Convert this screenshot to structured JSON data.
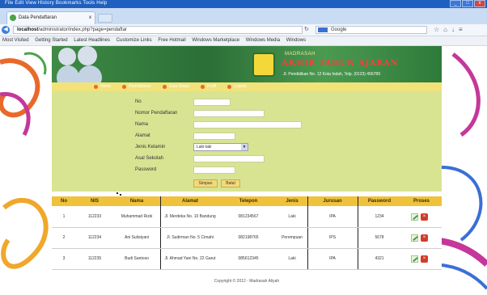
{
  "window": {
    "menu_text": "File  Edit  View  History  Bookmarks  Tools  Help",
    "min": "_",
    "max": "□",
    "close": "x"
  },
  "tab": {
    "label": "Data Pendaftaran",
    "close": "x"
  },
  "address": {
    "host": "localhost",
    "path": "/administrator/index.php?page=pendaftar",
    "search_engine": "Google",
    "search_placeholder": "Google"
  },
  "bookmarks": [
    "Most Visited",
    "Getting Started",
    "Latest Headlines",
    "Customize Links",
    "Free Hotmail",
    "Windows Marketplace",
    "Windows Media",
    "Windows"
  ],
  "banner": {
    "subtitle": "MADRASAH",
    "name": "AKHIR TAHUN AJARAN",
    "address": "Jl. Pendidikan No. 12 Kota Indah, Telp. (0123) 456789"
  },
  "menu": [
    "Home",
    "Pendaftaran",
    "Data Siswa",
    "Profil",
    "Logout"
  ],
  "form": {
    "fields": [
      "No",
      "Nomor Pendaftaran",
      "Nama",
      "Alamat",
      "Jenis Kelamin",
      "Asal Sekolah",
      "Password"
    ],
    "gender_selected": "Laki-laki",
    "submit_label": "Simpan",
    "reset_label": "Batal"
  },
  "table": {
    "headers": [
      "No",
      "NIS",
      "Nama",
      "Alamat",
      "Telepon",
      "Jenis",
      "Jurusan",
      "Password",
      "Proses"
    ],
    "rows": [
      [
        "1",
        "112233",
        "Muhammad Rizki",
        "Jl. Merdeka No. 10 Bandung",
        "081234567",
        "Laki",
        "IPA",
        "1234"
      ],
      [
        "2",
        "112234",
        "Ani Sulistyani",
        "Jl. Sudirman No. 5 Cimahi",
        "082198765",
        "Perempuan",
        "IPS",
        "5678"
      ],
      [
        "3",
        "112235",
        "Budi Santoso",
        "Jl. Ahmad Yani No. 22 Garut",
        "085612345",
        "Laki",
        "IPA",
        "4321"
      ]
    ]
  },
  "footer": "Copyright © 2012 - Madrasah Aliyah",
  "colors": {
    "banner": "#3f8a46",
    "menubar": "#f1e27a",
    "form": "#d9e493",
    "table_header": "#f0c23b",
    "title_bar": "#1f5fbf"
  },
  "icons": [
    "favicon",
    "back-icon",
    "reload-icon",
    "google-icon",
    "star-icon",
    "home-icon",
    "download-icon",
    "menu-icon",
    "edit-icon",
    "delete-icon"
  ]
}
